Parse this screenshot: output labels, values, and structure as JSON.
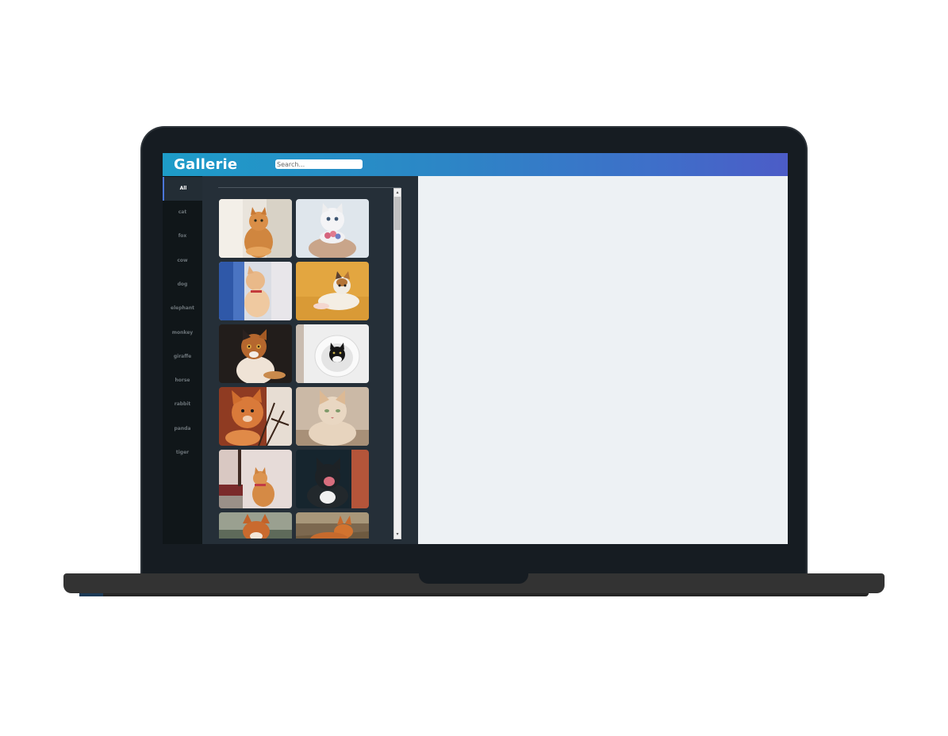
{
  "app": {
    "title": "Gallerie"
  },
  "search": {
    "placeholder": "Search..."
  },
  "sidebar": {
    "items": [
      {
        "label": "All",
        "active": true
      },
      {
        "label": "cat"
      },
      {
        "label": "fox"
      },
      {
        "label": "cow"
      },
      {
        "label": "dog"
      },
      {
        "label": "elephant"
      },
      {
        "label": "monkey"
      },
      {
        "label": "giraffe"
      },
      {
        "label": "horse"
      },
      {
        "label": "rabbit"
      },
      {
        "label": "panda"
      },
      {
        "label": "tiger"
      }
    ]
  },
  "gallery": {
    "images": [
      {
        "subject": "orange tabby cat",
        "icon": "photo-cat-orange",
        "color": "#c9894a"
      },
      {
        "subject": "white kitten with flowers",
        "icon": "photo-kitten-white",
        "color": "#e7e3e4"
      },
      {
        "subject": "cat behind blue curtain",
        "icon": "photo-cat-curtain",
        "color": "#3b5fa0"
      },
      {
        "subject": "calico kitten on yellow",
        "icon": "photo-kitten-yellow",
        "color": "#e0a83a"
      },
      {
        "subject": "calico cat dark background",
        "icon": "photo-cat-calico",
        "color": "#2a2320"
      },
      {
        "subject": "black and white cat in bowl",
        "icon": "photo-cat-bowl",
        "color": "#eeeeee"
      },
      {
        "subject": "orange cat with branches",
        "icon": "photo-cat-branches",
        "color": "#b0552c"
      },
      {
        "subject": "cream cat",
        "icon": "photo-cat-cream",
        "color": "#d7c3b0"
      },
      {
        "subject": "orange cat sitting",
        "icon": "photo-cat-sitting",
        "color": "#e8dcd8"
      },
      {
        "subject": "black cat yawning",
        "icon": "photo-cat-yawn",
        "color": "#1c2a33"
      },
      {
        "subject": "red fox",
        "icon": "photo-fox",
        "color": "#a55a2e"
      },
      {
        "subject": "fox lying in grass",
        "icon": "photo-fox-grass",
        "color": "#8a6a4a"
      }
    ]
  },
  "scrollbar": {
    "up_glyph": "▴",
    "down_glyph": "▾"
  }
}
